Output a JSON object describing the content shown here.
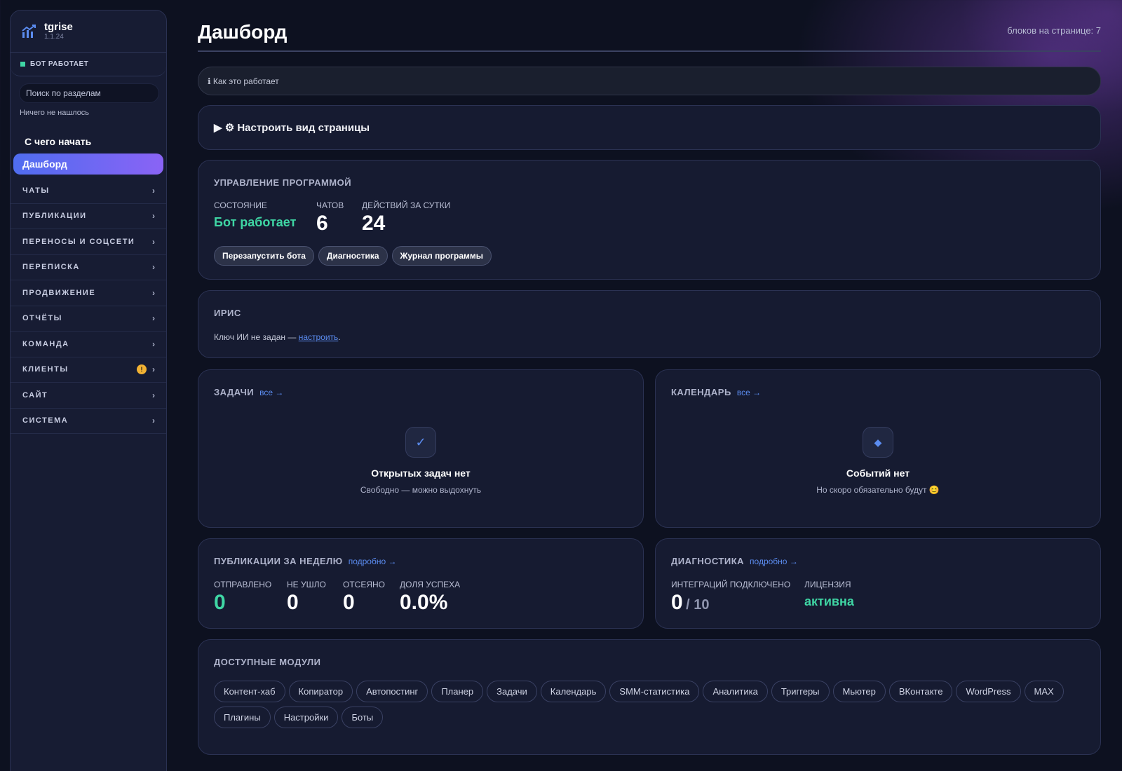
{
  "app": {
    "name": "tgrise",
    "version": "1.1.24"
  },
  "sidebar": {
    "status": "БОТ РАБОТАЕТ",
    "search_placeholder": "Поиск по разделам",
    "search_empty": "Ничего не нашлось",
    "start_label": "С чего начать",
    "active_label": "Дашборд",
    "items": [
      {
        "label": "ЧАТЫ",
        "badge": ""
      },
      {
        "label": "ПУБЛИКАЦИИ",
        "badge": ""
      },
      {
        "label": "ПЕРЕНОСЫ И СОЦСЕТИ",
        "badge": ""
      },
      {
        "label": "ПЕРЕПИСКА",
        "badge": ""
      },
      {
        "label": "ПРОДВИЖЕНИЕ",
        "badge": ""
      },
      {
        "label": "ОТЧЁТЫ",
        "badge": ""
      },
      {
        "label": "КОМАНДА",
        "badge": ""
      },
      {
        "label": "КЛИЕНТЫ",
        "badge": "!"
      },
      {
        "label": "САЙТ",
        "badge": ""
      },
      {
        "label": "СИСТЕМА",
        "badge": ""
      }
    ],
    "chevron": "›"
  },
  "header": {
    "title": "Дашборд",
    "blocks_count": "блоков на странице: 7"
  },
  "howto": "ℹ Как это работает",
  "customize": "▶ ⚙ Настроить вид страницы",
  "control": {
    "title": "УПРАВЛЕНИЕ ПРОГРАММОЙ",
    "state_label": "СОСТОЯНИЕ",
    "state_value": "Бот работает",
    "chats_label": "ЧАТОВ",
    "chats_value": "6",
    "actions_label": "ДЕЙСТВИЙ ЗА СУТКИ",
    "actions_value": "24",
    "buttons": [
      "Перезапустить бота",
      "Диагностика",
      "Журнал программы"
    ]
  },
  "iris": {
    "title": "ИРИС",
    "text": "Ключ ИИ не задан — ",
    "link": "настроить",
    "tail": "."
  },
  "tasks": {
    "title": "ЗАДАЧИ",
    "link": "все →",
    "icon": "✓",
    "empty_title": "Открытых задач нет",
    "empty_sub": "Свободно — можно выдохнуть"
  },
  "calendar": {
    "title": "КАЛЕНДАРЬ",
    "link": "все →",
    "icon": "◆",
    "empty_title": "Событий нет",
    "empty_sub": "Но скоро обязательно будут 😊"
  },
  "publications": {
    "title": "ПУБЛИКАЦИИ ЗА НЕДЕЛЮ",
    "link": "подробно →",
    "sent_label": "ОТПРАВЛЕНО",
    "sent": "0",
    "failed_label": "НЕ УШЛО",
    "failed": "0",
    "filtered_label": "ОТСЕЯНО",
    "filtered": "0",
    "success_label": "ДОЛЯ УСПЕХА",
    "success": "0.0%"
  },
  "diagnostics": {
    "title": "ДИАГНОСТИКА",
    "link": "подробно →",
    "integrations_label": "ИНТЕГРАЦИЙ ПОДКЛЮЧЕНО",
    "integrations_value": "0",
    "integrations_total": "/ 10",
    "license_label": "ЛИЦЕНЗИЯ",
    "license_value": "активна"
  },
  "modules": {
    "title": "ДОСТУПНЫЕ МОДУЛИ",
    "items": [
      "Контент-хаб",
      "Копиратор",
      "Автопостинг",
      "Планер",
      "Задачи",
      "Календарь",
      "SMM-статистика",
      "Аналитика",
      "Триггеры",
      "Мьютер",
      "ВКонтакте",
      "WordPress",
      "MAX",
      "Плагины",
      "Настройки",
      "Боты"
    ]
  },
  "colors": {
    "accent": "#5b8cf0",
    "success": "#3fd6a4",
    "warning": "#f2b233",
    "background": "#0d1120",
    "card": "#161b31"
  }
}
